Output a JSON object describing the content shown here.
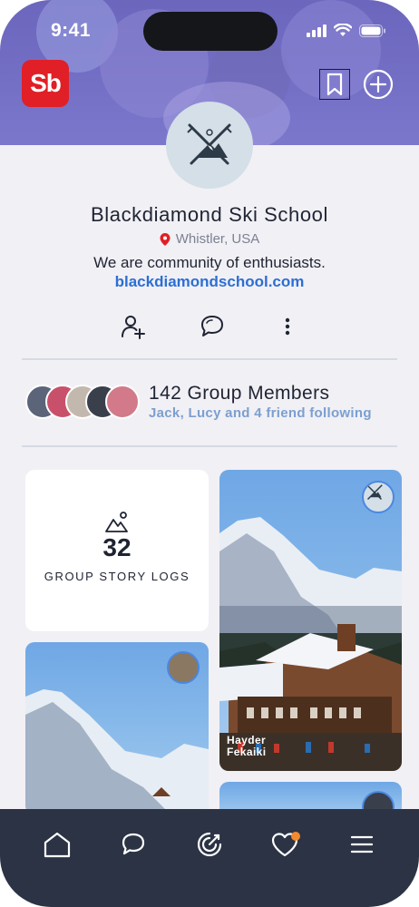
{
  "status": {
    "time": "9:41"
  },
  "app": {
    "logo_text": "Sb"
  },
  "header": {
    "bookmark_icon": "bookmark-icon",
    "add_icon": "add-circle-icon"
  },
  "profile": {
    "name": "Blackdiamond Ski School",
    "location": "Whistler, USA",
    "bio": "We are community of enthusiasts.",
    "website": "blackdiamondschool.com"
  },
  "actions": [
    {
      "name": "follow",
      "icon": "add-user-icon"
    },
    {
      "name": "message",
      "icon": "chat-icon"
    },
    {
      "name": "more",
      "icon": "more-vertical-icon"
    }
  ],
  "members": {
    "title": "142 Group Members",
    "subtitle": "Jack, Lucy and 4 friend following"
  },
  "stats": {
    "count": "32",
    "label": "GROUP STORY LOGS"
  },
  "feed": {
    "right_card_author": "Hayder\nFekaiki",
    "right_card_author_line1": "Hayder",
    "right_card_author_line2": "Fekaiki"
  },
  "tabbar": [
    "home-icon",
    "chat-icon",
    "target-icon",
    "heart-icon",
    "menu-icon"
  ],
  "colors": {
    "brand": "#e11f26",
    "link": "#2c6fd2",
    "tabbar": "#2b3345",
    "accent": "#f28a2e"
  }
}
